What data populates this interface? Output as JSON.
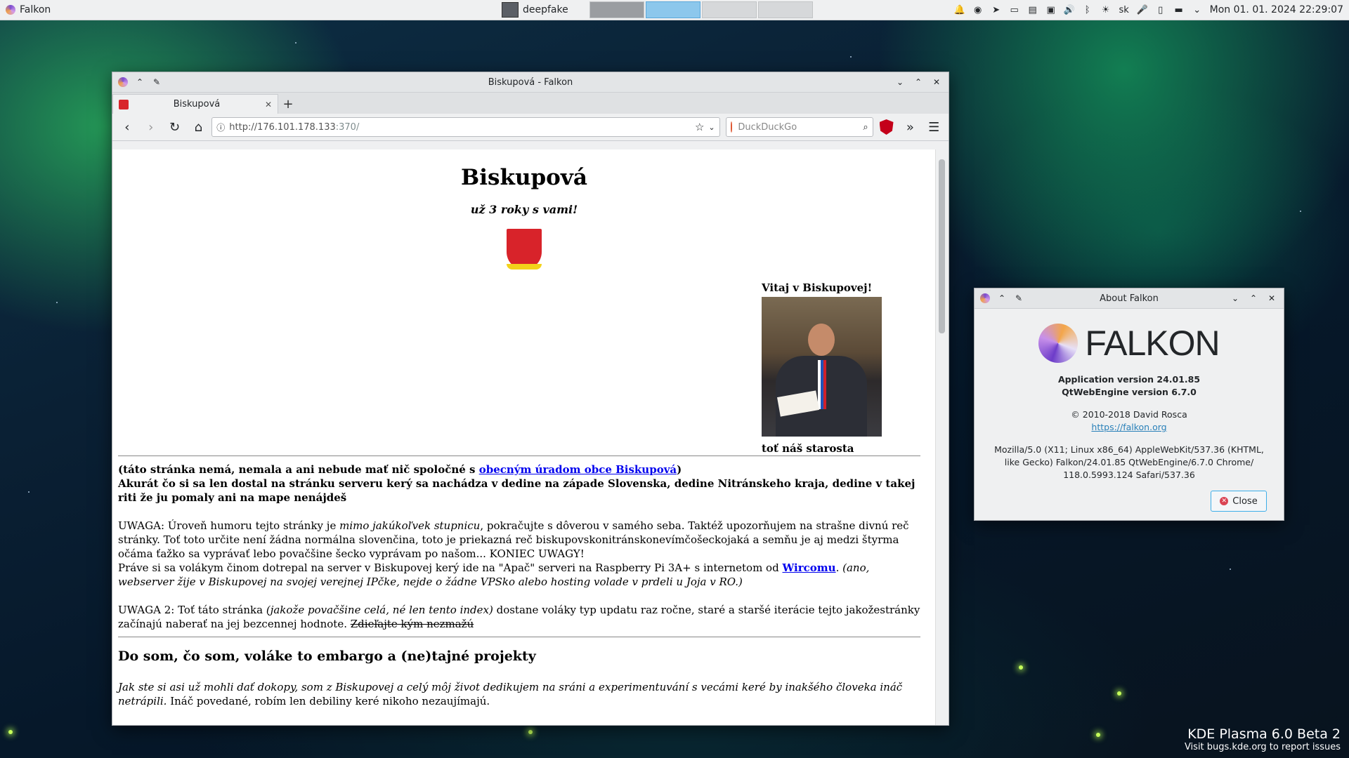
{
  "panel": {
    "active_app": "Falkon",
    "task": "deepfake",
    "keyboard_layout": "sk",
    "clock": "Mon 01. 01. 2024  22:29:07"
  },
  "browser": {
    "window_title": "Biskupová - Falkon",
    "tab_title": "Biskupová",
    "url_scheme_host": "http://176.101.178.133",
    "url_path": ":370/",
    "search_placeholder": "DuckDuckGo"
  },
  "page": {
    "title": "Biskupová",
    "tagline": "už 3 roky s vami!",
    "welcome": "Vitaj v Biskupovej!",
    "mayor_caption": "toť náš starosta",
    "notice_prefix": "(táto stránka nemá, nemala a ani nebude mať nič spoločné s ",
    "notice_link": "obecným úradom obce Biskupová",
    "notice_suffix": ")",
    "notice_line2": "Akurát čo si sa len dostal na stránku serveru kerý sa nachádza v dedine na západe Slovenska, dedine Nitránskeho kraja, dedine v takej riti že ju pomaly ani na mape nenájdeš",
    "warning1_a": "UWAGA: Úroveň humoru tejto stránky je ",
    "warning1_em": "mimo jakúkoľvek stupnicu",
    "warning1_b": ", pokračujte s dôverou v samého seba. Taktéž upozorňujem na strašne divnú reč stránky. Toť toto určite není žádna normálna slovenčina, toto je priekazná reč biskupovskonitránskonevímčošeckojaká a semňu je aj medzi štyrma očáma ťažko sa vyprávať lebo povačšine šecko vyprávam po našom... KONIEC UWAGY!",
    "server_a": "Práve si sa volákym činom dotrepal na server v Biskupovej kerý ide na \"Apač\" serveri na Raspberry Pi 3A+ s internetom od ",
    "server_link": "Wircomu",
    "server_b": ". ",
    "server_em": "(ano, webserver žije v Biskupovej na svojej verejnej IPčke, nejde o žádne VPSko alebo hosting volade v prdeli u Joja v RO.)",
    "warning2_a": "UWAGA 2: Toť táto stránka ",
    "warning2_em": "(jakože povačšine celá, né len tento index)",
    "warning2_b": " dostane voláky typ updatu raz ročne, staré a staršé iterácie tejto jakožestránky začínajú naberať na jej bezcennej hodnote. ",
    "warning2_strike": "Zdieľajte kým nezmažú",
    "section_heading": "Do som, čo som, voláke to embargo a (ne)tajné projekty",
    "section_text_em": "Jak ste si asi už mohli dať dokopy, som z Biskupovej a celý môj život dedikujem na sráni a experimentuvání s vecámi keré by inakšého človeka ináč netrápili.",
    "section_text": " Ináč povedané, robím len debiliny keré nikoho nezaujímajú."
  },
  "about": {
    "window_title": "About Falkon",
    "logo_text": "FALKON",
    "app_version": "Application version 24.01.85",
    "webengine_version": "QtWebEngine version 6.7.0",
    "copyright": "© 2010-2018 David Rosca",
    "website": "https://falkon.org",
    "user_agent": "Mozilla/5.0 (X11; Linux x86_64) AppleWebKit/537.36 (KHTML, like Gecko) Falkon/24.01.85 QtWebEngine/6.7.0 Chrome/ 118.0.5993.124 Safari/537.36",
    "close_label": "Close"
  },
  "desktop": {
    "watermark_title": "KDE Plasma 6.0 Beta 2",
    "watermark_sub": "Visit bugs.kde.org to report issues"
  }
}
